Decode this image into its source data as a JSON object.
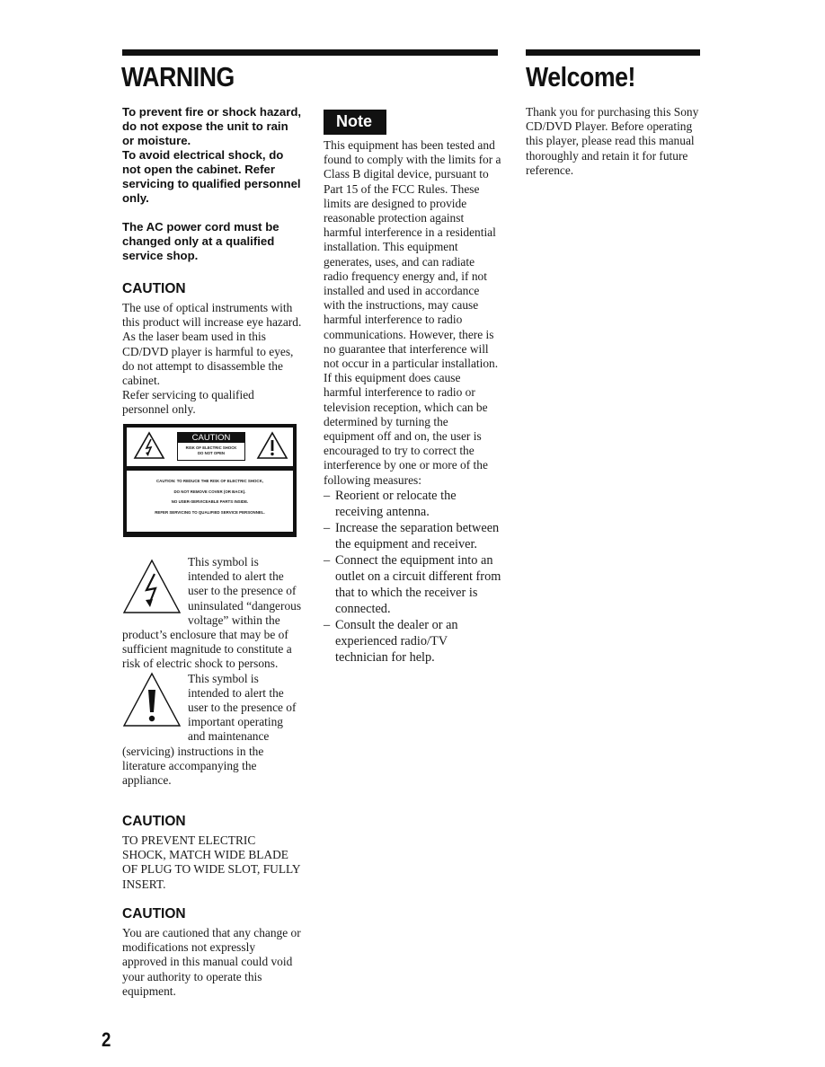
{
  "warning": {
    "title": "WARNING",
    "bold_paragraph_1": "To prevent fire or shock hazard, do not expose the unit to rain or moisture.",
    "bold_paragraph_2": "To avoid electrical shock, do not open the cabinet. Refer servicing to qualified personnel only.",
    "bold_paragraph_3": "The AC power cord must be changed only at a qualified service shop.",
    "caution_1": {
      "heading": "CAUTION",
      "text": "The use of optical instruments with this product will increase eye hazard. As the laser beam used in this CD/DVD player is harmful to eyes, do not attempt to disassemble the cabinet.",
      "text_2": "Refer servicing to qualified personnel only."
    },
    "caution_label": {
      "title": "CAUTION",
      "subtitle_1": "RISK OF ELECTRIC SHOCK",
      "subtitle_2": "DO NOT OPEN",
      "lines": [
        "CAUTION: TO REDUCE THE RISK OF ELECTRIC SHOCK,",
        "DO NOT REMOVE COVER (OR BACK).",
        "NO USER-SERVICEABLE PARTS INSIDE.",
        "REFER SERVICING TO QUALIFIED SERVICE PERSONNEL."
      ]
    },
    "symbol_voltage": {
      "icon": "lightning-triangle-icon",
      "text": "This symbol is intended to alert the user to the presence of uninsulated “dangerous voltage” within the product’s enclosure that may be of sufficient magnitude to constitute a risk of electric shock to persons."
    },
    "symbol_important": {
      "icon": "exclamation-triangle-icon",
      "text": "This symbol is intended to alert the user to the presence of important operating and maintenance (servicing) instructions in the literature accompanying the appliance."
    },
    "caution_2": {
      "heading": "CAUTION",
      "text": "TO PREVENT ELECTRIC SHOCK, MATCH WIDE BLADE OF PLUG TO WIDE SLOT, FULLY INSERT."
    },
    "caution_3": {
      "heading": "CAUTION",
      "text": "You are cautioned that any change or modifications not expressly approved in this manual could void your authority to operate this equipment."
    }
  },
  "note": {
    "badge": "Note",
    "text": "This equipment has been tested and found to comply with the limits for a Class B digital device, pursuant to Part 15 of the FCC Rules. These limits are designed to provide reasonable protection against harmful interference in a residential installation. This equipment generates, uses, and can radiate radio frequency energy and, if not installed and used in accordance with the instructions, may cause harmful interference to radio communications. However, there is no guarantee that interference will not occur in a particular installation. If this equipment does cause harmful interference to radio or television reception, which can be determined by turning the equipment off and on, the user is encouraged to try to correct the interference by one or more of the following measures:",
    "bullet_marker": "–",
    "measures": [
      "Reorient or relocate the receiving antenna.",
      "Increase the separation between the equipment and receiver.",
      "Connect the equipment into an outlet on a circuit different from that to which the receiver is connected.",
      "Consult the dealer or an experienced radio/TV technician for help."
    ]
  },
  "welcome": {
    "title": "Welcome!",
    "text": "Thank you for purchasing this Sony CD/DVD Player. Before operating this player, please read this manual thoroughly and retain it for future reference."
  },
  "page_number": "2"
}
